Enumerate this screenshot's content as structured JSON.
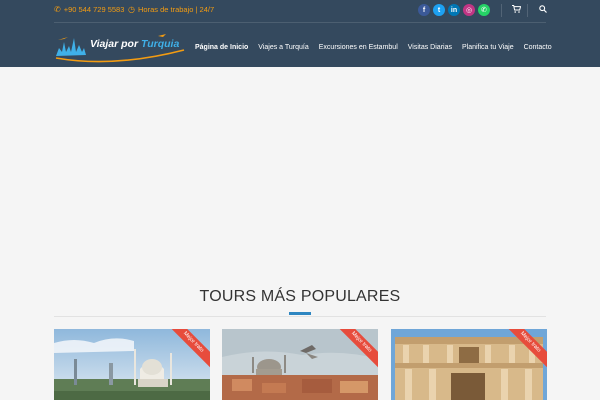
{
  "topbar": {
    "phone": "+90 544 729 5583",
    "hours": "Horas de trabajo | 24/7",
    "social": [
      {
        "name": "facebook",
        "glyph": "f",
        "color": "#3b5998"
      },
      {
        "name": "twitter",
        "glyph": "t",
        "color": "#1da1f2"
      },
      {
        "name": "linkedin",
        "glyph": "in",
        "color": "#0077b5"
      },
      {
        "name": "instagram",
        "glyph": "◎",
        "color": "#c13584"
      },
      {
        "name": "whatsapp",
        "glyph": "✆",
        "color": "#25d366"
      }
    ],
    "cart_icon": "cart-icon",
    "search_icon": "search-icon"
  },
  "logo": {
    "text_a": "Viajar por ",
    "text_b": "Turquia"
  },
  "nav": [
    {
      "label": "Página de Inicio",
      "active": true
    },
    {
      "label": "Viajes a Turquía",
      "active": false
    },
    {
      "label": "Excursiones en Estambul",
      "active": false
    },
    {
      "label": "Visitas Diarias",
      "active": false
    },
    {
      "label": "Planifica tu Viaje",
      "active": false
    },
    {
      "label": "Contacto",
      "active": false
    }
  ],
  "section": {
    "title": "TOURS MÁS POPULARES"
  },
  "cards": [
    {
      "badge": "Mejor trato"
    },
    {
      "badge": "Mejor trato"
    },
    {
      "badge": "Mejor trato"
    }
  ],
  "colors": {
    "header_bg": "#34495e",
    "accent_orange": "#f39c12",
    "accent_blue": "#2e86c1",
    "ribbon_red": "#e74c3c"
  }
}
